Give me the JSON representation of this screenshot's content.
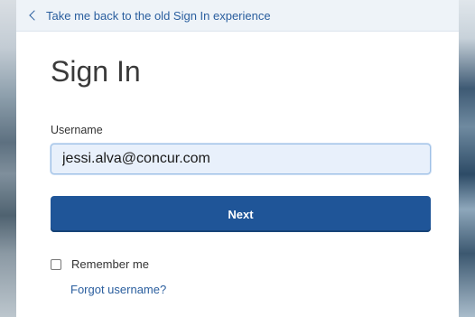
{
  "back_link": {
    "label": "Take me back to the old Sign In experience"
  },
  "signin": {
    "title": "Sign In",
    "username_label": "Username",
    "username_value": "jessi.alva@concur.com",
    "next_label": "Next",
    "remember_label": "Remember me",
    "remember_checked": false,
    "forgot_label": "Forgot username?"
  },
  "colors": {
    "primary_button": "#1f5598",
    "link": "#2a5e9e",
    "input_background": "#e8f0fb"
  }
}
